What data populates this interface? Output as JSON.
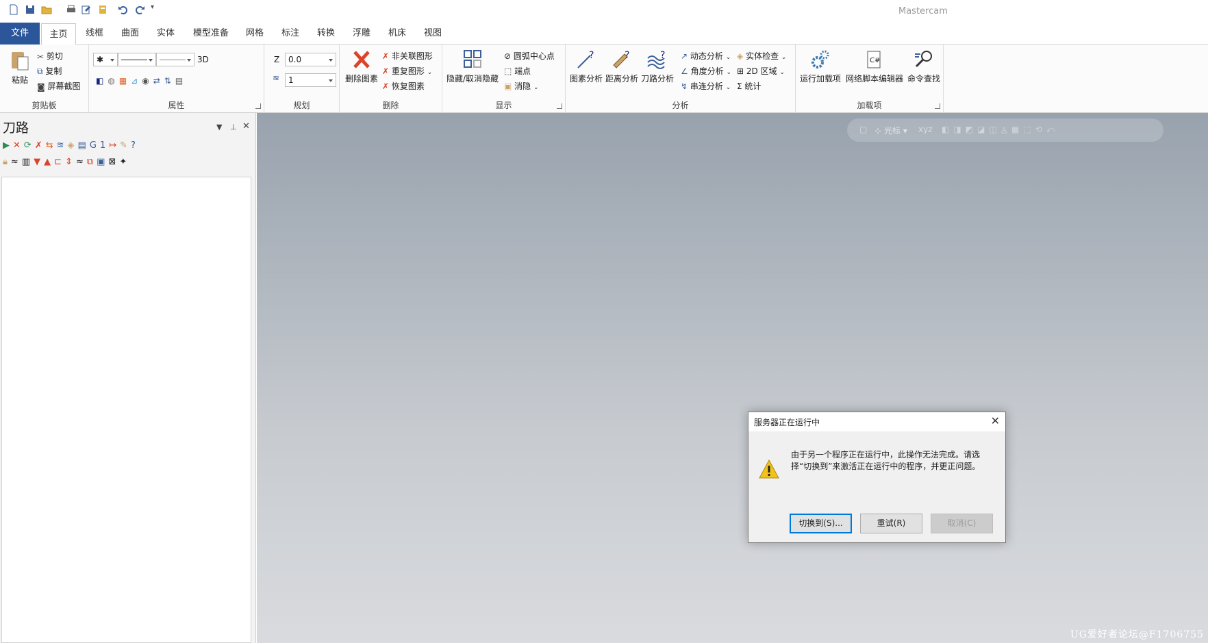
{
  "app": {
    "title": "Mastercam"
  },
  "tabs": [
    {
      "label": "文件"
    },
    {
      "label": "主页"
    },
    {
      "label": "线框"
    },
    {
      "label": "曲面"
    },
    {
      "label": "实体"
    },
    {
      "label": "模型准备"
    },
    {
      "label": "网格"
    },
    {
      "label": "标注"
    },
    {
      "label": "转换"
    },
    {
      "label": "浮雕"
    },
    {
      "label": "机床"
    },
    {
      "label": "视图"
    }
  ],
  "ribbon": {
    "clipboard": {
      "label": "剪贴板",
      "paste": "粘贴",
      "cut": "剪切",
      "copy": "复制",
      "screenshot": "屏幕截图"
    },
    "attributes": {
      "label": "属性",
      "mode": "3D"
    },
    "planning": {
      "label": "规划",
      "z_label": "Z",
      "z_value": "0.0",
      "level_value": "1"
    },
    "delete": {
      "label": "删除",
      "delete_entities": "删除图素",
      "non_assoc": "非关联图形",
      "duplicate": "重复图形",
      "restore": "恢复图素"
    },
    "display": {
      "label": "显示",
      "hide_unhide": "隐藏/取消隐藏",
      "arc_center": "圆弧中心点",
      "endpoints": "端点",
      "blank": "消隐"
    },
    "analyze": {
      "label": "分析",
      "entity": "图素分析",
      "distance": "距离分析",
      "toolpath": "刀路分析",
      "dynamic": "动态分析",
      "angle": "角度分析",
      "chain": "串连分析",
      "solid_check": "实体检查",
      "area_2d": "2D 区域",
      "stats": "统计"
    },
    "addins": {
      "label": "加载项",
      "run_addin": "运行加载项",
      "net_script": "网络脚本编辑器",
      "cmd_finder": "命令查找"
    }
  },
  "panel": {
    "title": "刀路"
  },
  "viewport": {
    "toolbar_cursor": "光标",
    "watermark": "UG爱好者论坛@F1706755"
  },
  "dialog": {
    "title": "服务器正在运行中",
    "message": "由于另一个程序正在运行中，此操作无法完成。请选择“切换到”来激活正在运行中的程序，并更正问题。",
    "switch_to": "切换到(S)...",
    "retry": "重试(R)",
    "cancel": "取消(C)"
  },
  "colors": {
    "file_tab": "#2b579a",
    "delete_x": "#d9442b",
    "dialog_focus": "#0078d7"
  }
}
